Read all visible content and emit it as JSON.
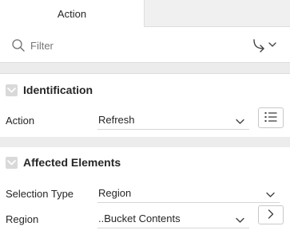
{
  "tabs": [
    {
      "label": "Action"
    }
  ],
  "filter": {
    "placeholder": "Filter"
  },
  "sections": {
    "identification": {
      "title": "Identification",
      "action": {
        "label": "Action",
        "value": "Refresh"
      }
    },
    "affected_elements": {
      "title": "Affected Elements",
      "selection_type": {
        "label": "Selection Type",
        "value": "Region"
      },
      "region": {
        "label": "Region",
        "value": "..Bucket Contents"
      }
    }
  },
  "icons": {
    "search": "search-icon",
    "goto": "goto-arrow-icon",
    "collapse": "chevron-down-icon",
    "list": "list-icon",
    "navigate": "chevron-right-icon"
  },
  "colors": {
    "tab_strip": "#f0f0f0",
    "separator": "#ececec",
    "collapse_box": "#d9d9d9"
  }
}
